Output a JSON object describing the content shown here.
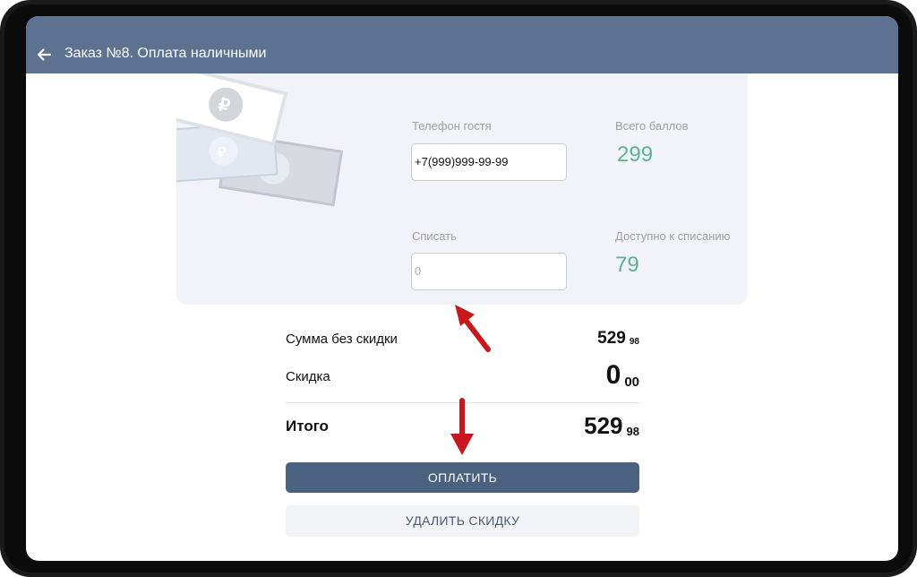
{
  "header": {
    "title": "Заказ №8. Оплата наличными",
    "back_icon": "arrow-left-icon"
  },
  "points": {
    "phone_label": "Телефон гостя",
    "phone_value": "+7(999)999-99-99",
    "total_points_label": "Всего баллов",
    "total_points_value": "299",
    "writeoff_label": "Списать",
    "writeoff_placeholder": "0",
    "available_label": "Доступно к списанию",
    "available_value": "79"
  },
  "summary": {
    "subtotal_label": "Сумма без скидки",
    "subtotal_main": "529",
    "subtotal_cents": "98",
    "discount_label": "Скидка",
    "discount_main": "0",
    "discount_cents": "00",
    "total_label": "Итого",
    "total_main": "529",
    "total_cents": "98"
  },
  "actions": {
    "pay_label": "ОПЛАТИТЬ",
    "remove_discount_label": "УДАЛИТЬ СКИДКУ"
  },
  "colors": {
    "appbar": "#5c7290",
    "accent_green": "#5bb391",
    "pay_button": "#4a6180",
    "annotation_arrow": "#c8181e"
  }
}
